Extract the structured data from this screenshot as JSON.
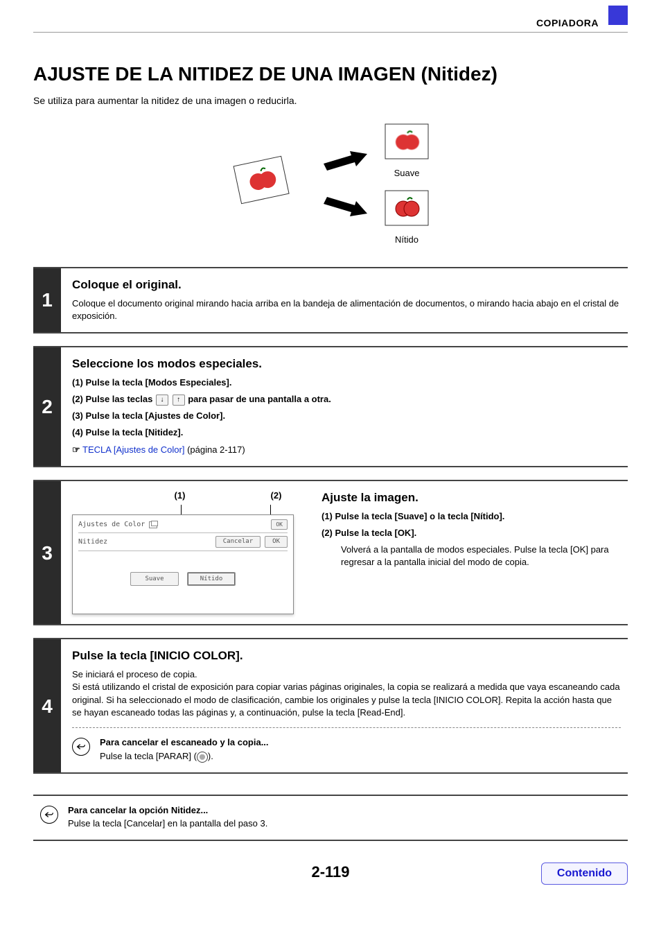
{
  "header": {
    "section": "COPIADORA"
  },
  "title": "AJUSTE DE LA NITIDEZ DE UNA IMAGEN (Nitidez)",
  "subtitle": "Se utiliza para aumentar la nitidez de una imagen o reducirla.",
  "illustration": {
    "soft_label": "Suave",
    "sharp_label": "Nítido"
  },
  "step1": {
    "num": "1",
    "title": "Coloque el original.",
    "text": "Coloque el documento original mirando hacia arriba en la bandeja de alimentación de documentos, o mirando hacia abajo en el cristal de exposición."
  },
  "step2": {
    "num": "2",
    "title": "Seleccione los modos especiales.",
    "s1": "(1)  Pulse la tecla [Modos Especiales].",
    "s2_a": "(2)  Pulse las teclas ",
    "s2_b": " para pasar de una pantalla a otra.",
    "s3": "(3)  Pulse la tecla [Ajustes de Color].",
    "s4": "(4)  Pulse la tecla [Nitidez].",
    "ref_link": "TECLA [Ajustes de Color]",
    "ref_suffix": " (página 2-117)"
  },
  "step3": {
    "num": "3",
    "callout1": "(1)",
    "callout2": "(2)",
    "screen": {
      "header_label": "Ajustes de Color",
      "ok_top": "OK",
      "nit_label": "Nitidez",
      "cancel": "Cancelar",
      "ok_mid": "OK",
      "soft": "Suave",
      "sharp": "Nítido"
    },
    "right_title": "Ajuste la imagen.",
    "r1": "(1)  Pulse la tecla [Suave] o la tecla [Nítido].",
    "r2_label": "(2)  Pulse la tecla [OK].",
    "r2_text": "Volverá a la pantalla de modos especiales. Pulse la tecla [OK] para regresar a la pantalla inicial del modo de copia."
  },
  "step4": {
    "num": "4",
    "title": "Pulse la tecla [INICIO COLOR].",
    "p1": "Se iniciará el proceso de copia.",
    "p2": "Si está utilizando el cristal de exposición para copiar varias páginas originales, la copia se realizará a medida que vaya escaneando cada original. Si ha seleccionado el modo de clasificación, cambie los originales y pulse la tecla [INICIO COLOR]. Repita la acción hasta que se hayan escaneado todas las páginas y, a continuación, pulse la tecla [Read-End].",
    "cancel_scan_title": "Para cancelar el escaneado y la copia...",
    "cancel_scan_text_a": "Pulse la tecla [PARAR] (",
    "cancel_scan_text_b": ")."
  },
  "final": {
    "title": "Para cancelar la opción Nitidez...",
    "text": "Pulse la tecla [Cancelar] en la pantalla del paso 3."
  },
  "page_number": "2-119",
  "contents_label": "Contenido"
}
